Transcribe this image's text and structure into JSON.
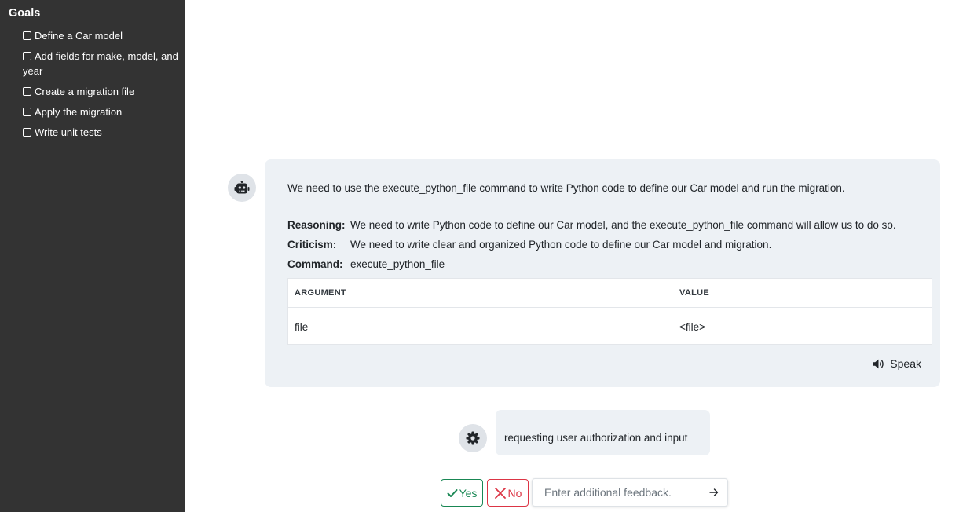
{
  "sidebar": {
    "title": "Goals",
    "goals": [
      {
        "label": "Define a Car model",
        "checked": false
      },
      {
        "label": "Add fields for make, model, and year",
        "checked": false
      },
      {
        "label": "Create a migration file",
        "checked": false
      },
      {
        "label": "Apply the migration",
        "checked": false
      },
      {
        "label": "Write unit tests",
        "checked": false
      }
    ]
  },
  "bot_message": {
    "avatar_icon": "robot-icon",
    "thought": "We need to use the execute_python_file command to write Python code to define our Car model and run the migration.",
    "reasoning_label": "Reasoning:",
    "reasoning": "We need to write Python code to define our Car model, and the execute_python_file command will allow us to do so.",
    "criticism_label": "Criticism:",
    "criticism": "We need to write clear and organized Python code to define our Car model and migration.",
    "command_label": "Command:",
    "command": "execute_python_file",
    "args_table": {
      "headers": [
        "ARGUMENT",
        "VALUE"
      ],
      "rows": [
        [
          "file",
          "<file>"
        ]
      ]
    },
    "speak_label": "Speak",
    "speak_icon": "volume-icon"
  },
  "system_message": {
    "avatar_icon": "gear-icon",
    "text": "requesting user authorization and input"
  },
  "actions": {
    "yes_label": "Yes",
    "no_label": "No",
    "feedback_placeholder": "Enter additional feedback.",
    "send_icon": "arrow-right-icon"
  },
  "colors": {
    "sidebar_bg": "#333333",
    "bubble_bg": "#edf1f5",
    "yes": "#198754",
    "no": "#dc3545"
  }
}
